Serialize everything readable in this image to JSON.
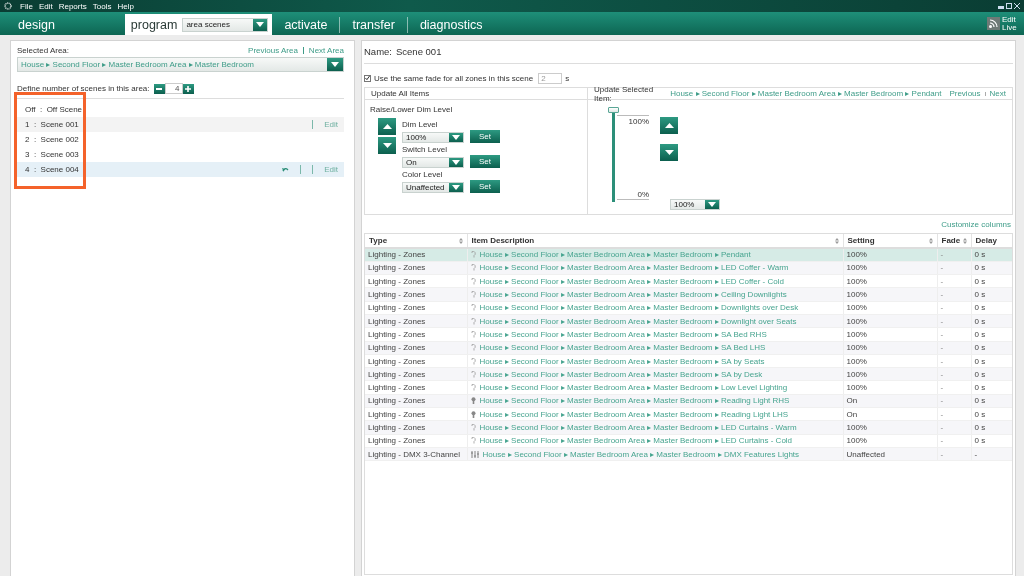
{
  "menu": [
    "File",
    "Edit",
    "Reports",
    "Tools",
    "Help"
  ],
  "tabs": [
    {
      "label": "design",
      "selected": false
    },
    {
      "label": "program",
      "selected": true,
      "dropdown": "area scenes"
    },
    {
      "label": "activate",
      "selected": false
    },
    {
      "label": "transfer",
      "selected": false
    },
    {
      "label": "diagnostics",
      "selected": false
    }
  ],
  "edit_live": "Edit Live",
  "left_panel": {
    "selected_area_label": "Selected Area:",
    "previous_link": "Previous Area",
    "next_link": "Next Area",
    "area_path": "House ▸ Second Floor ▸ Master Bedroom Area ▸ Master Bedroom",
    "scene_count_label": "Define number of scenes in this area:",
    "scene_count": "4",
    "scenes": [
      {
        "label": "Off  :  Off Scene",
        "selected": false,
        "hovered": false,
        "undo": false
      },
      {
        "label": "1  :  Scene 001",
        "selected": true,
        "hovered": false,
        "undo": false,
        "edit_link": "Edit"
      },
      {
        "label": "2  :  Scene 002",
        "selected": false,
        "hovered": false,
        "undo": false
      },
      {
        "label": "3  :  Scene 003",
        "selected": false,
        "hovered": false,
        "undo": false
      },
      {
        "label": "4  :  Scene 004",
        "selected": false,
        "hovered": true,
        "undo": true,
        "edit_link": "Edit"
      }
    ]
  },
  "scene_header": {
    "name_label": "Name:",
    "name": "Scene 001",
    "same_fade_checked": true,
    "same_fade_label": "Use the same fade for all zones in this scene",
    "fade_value": "2",
    "fade_unit": "s"
  },
  "update_all": {
    "title": "Update All Items",
    "subtitle": "Raise/Lower Dim Level",
    "controls": [
      {
        "label": "Dim Level",
        "value": "100%",
        "button": "Set"
      },
      {
        "label": "Switch Level",
        "value": "On",
        "button": "Set"
      },
      {
        "label": "Color Level",
        "value": "Unaffected",
        "button": "Set"
      }
    ]
  },
  "update_selected": {
    "title": "Update Selected Item:",
    "path": "House ▸ Second Floor ▸ Master Bedroom Area ▸ Master Bedroom ▸ Pendant",
    "previous_link": "Previous",
    "next_link": "Next",
    "slider": {
      "level": 1,
      "max_label": "100%",
      "min_label": "0%"
    },
    "value": "100%"
  },
  "customize_link": "Customize columns",
  "table": {
    "columns": [
      "Type",
      "Item Description",
      "Setting",
      "Fade",
      "Delay"
    ],
    "rows": [
      {
        "type": "Lighting - Zones",
        "kind": "dimmer",
        "description": "House ▸ Second Floor ▸ Master Bedroom Area ▸ Master Bedroom ▸ Pendant",
        "setting": "100%",
        "fade": "-",
        "delay": "0 s",
        "selected": true
      },
      {
        "type": "Lighting - Zones",
        "kind": "dimmer",
        "description": "House ▸ Second Floor ▸ Master Bedroom Area ▸ Master Bedroom ▸ LED  Coffer - Warm",
        "setting": "100%",
        "fade": "-",
        "delay": "0 s",
        "selected": false
      },
      {
        "type": "Lighting - Zones",
        "kind": "dimmer",
        "description": "House ▸ Second Floor ▸ Master Bedroom Area ▸ Master Bedroom ▸ LED  Coffer - Cold",
        "setting": "100%",
        "fade": "-",
        "delay": "0 s",
        "selected": false
      },
      {
        "type": "Lighting - Zones",
        "kind": "dimmer",
        "description": "House ▸ Second Floor ▸ Master Bedroom Area ▸ Master Bedroom ▸ Ceiling Downlights",
        "setting": "100%",
        "fade": "-",
        "delay": "0 s",
        "selected": false
      },
      {
        "type": "Lighting - Zones",
        "kind": "dimmer",
        "description": "House ▸ Second Floor ▸ Master Bedroom Area ▸ Master Bedroom ▸ Downlights over Desk",
        "setting": "100%",
        "fade": "-",
        "delay": "0 s",
        "selected": false
      },
      {
        "type": "Lighting - Zones",
        "kind": "dimmer",
        "description": "House ▸ Second Floor ▸ Master Bedroom Area ▸ Master Bedroom ▸ Downlight over Seats",
        "setting": "100%",
        "fade": "-",
        "delay": "0 s",
        "selected": false
      },
      {
        "type": "Lighting - Zones",
        "kind": "dimmer",
        "description": "House ▸ Second Floor ▸ Master Bedroom Area ▸ Master Bedroom ▸ SA Bed RHS",
        "setting": "100%",
        "fade": "-",
        "delay": "0 s",
        "selected": false
      },
      {
        "type": "Lighting - Zones",
        "kind": "dimmer",
        "description": "House ▸ Second Floor ▸ Master Bedroom Area ▸ Master Bedroom ▸ SA Bed LHS",
        "setting": "100%",
        "fade": "-",
        "delay": "0 s",
        "selected": false
      },
      {
        "type": "Lighting - Zones",
        "kind": "dimmer",
        "description": "House ▸ Second Floor ▸ Master Bedroom Area ▸ Master Bedroom ▸ SA by Seats",
        "setting": "100%",
        "fade": "-",
        "delay": "0 s",
        "selected": false
      },
      {
        "type": "Lighting - Zones",
        "kind": "dimmer",
        "description": "House ▸ Second Floor ▸ Master Bedroom Area ▸ Master Bedroom ▸ SA by Desk",
        "setting": "100%",
        "fade": "-",
        "delay": "0 s",
        "selected": false
      },
      {
        "type": "Lighting - Zones",
        "kind": "dimmer",
        "description": "House ▸ Second Floor ▸ Master Bedroom Area ▸ Master Bedroom ▸ Low Level Lighting",
        "setting": "100%",
        "fade": "-",
        "delay": "0 s",
        "selected": false
      },
      {
        "type": "Lighting - Zones",
        "kind": "switch",
        "description": "House ▸ Second Floor ▸ Master Bedroom Area ▸ Master Bedroom ▸ Reading Light RHS",
        "setting": "On",
        "fade": "-",
        "delay": "0 s",
        "selected": false
      },
      {
        "type": "Lighting - Zones",
        "kind": "switch",
        "description": "House ▸ Second Floor ▸ Master Bedroom Area ▸ Master Bedroom ▸ Reading Light LHS",
        "setting": "On",
        "fade": "-",
        "delay": "0 s",
        "selected": false
      },
      {
        "type": "Lighting - Zones",
        "kind": "dimmer",
        "description": "House ▸ Second Floor ▸ Master Bedroom Area ▸ Master Bedroom ▸ LED Curtains - Warm",
        "setting": "100%",
        "fade": "-",
        "delay": "0 s",
        "selected": false
      },
      {
        "type": "Lighting - Zones",
        "kind": "dimmer",
        "description": "House ▸ Second Floor ▸ Master Bedroom Area ▸ Master Bedroom ▸ LED Curtains - Cold",
        "setting": "100%",
        "fade": "-",
        "delay": "0 s",
        "selected": false
      },
      {
        "type": "Lighting - DMX 3-Channel",
        "kind": "dmx",
        "description": "House ▸ Second Floor ▸ Master Bedroom Area ▸ Master Bedroom ▸ DMX Features Lights",
        "setting": "Unaffected",
        "fade": "-",
        "delay": "-",
        "selected": false
      }
    ]
  }
}
